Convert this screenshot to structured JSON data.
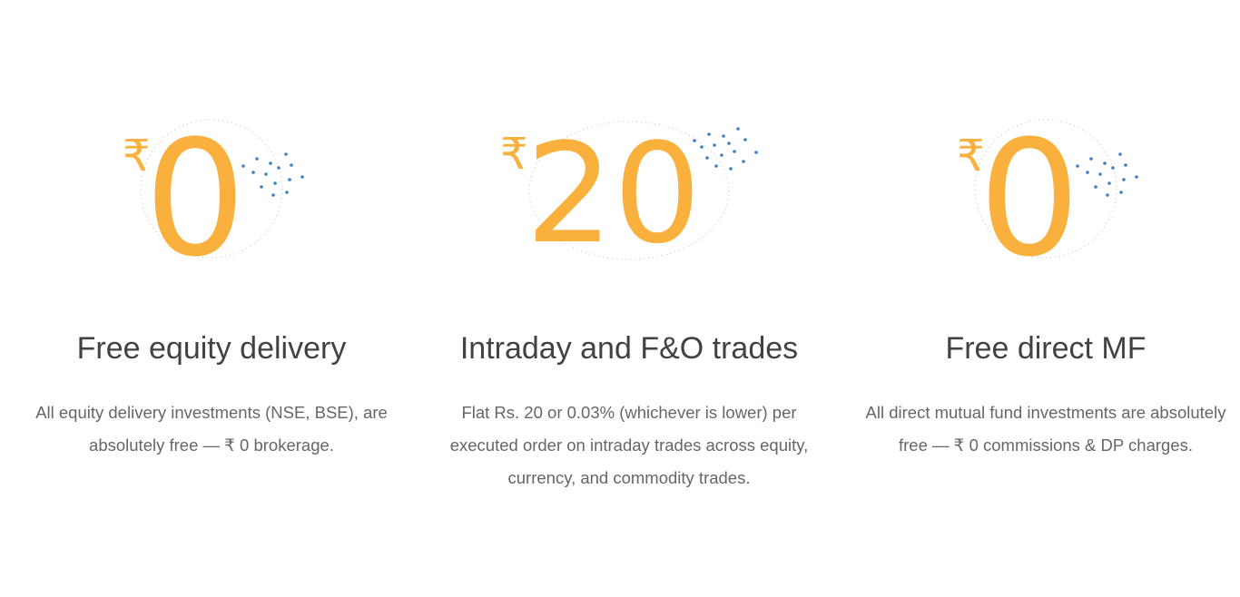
{
  "cards": [
    {
      "amount": "0",
      "currency": "₹",
      "title": "Free equity delivery",
      "description": "All equity delivery investments (NSE, BSE), are absolutely free — ₹ 0 brokerage."
    },
    {
      "amount": "20",
      "currency": "₹",
      "title": "Intraday and F&O trades",
      "description": "Flat Rs. 20 or 0.03% (whichever is lower) per executed order on intraday trades across equity, currency, and commodity trades."
    },
    {
      "amount": "0",
      "currency": "₹",
      "title": "Free direct MF",
      "description": "All direct mutual fund investments are absolutely free — ₹ 0 commissions & DP charges."
    }
  ],
  "colors": {
    "accent": "#f9b03c",
    "dots": "#3d7fc4",
    "title": "#424242",
    "text": "#666666"
  }
}
